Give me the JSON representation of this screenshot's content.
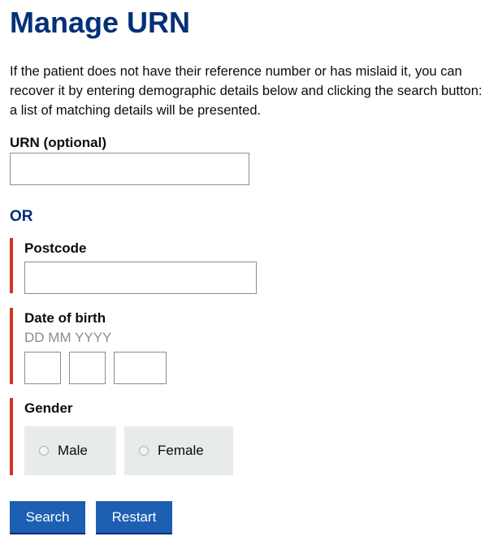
{
  "page": {
    "title": "Manage URN",
    "intro": "If the patient does not have their reference number or has mislaid it, you can recover it by entering demographic details below and clicking the search button: a list of matching details will be presented."
  },
  "urn": {
    "label": "URN (optional)",
    "value": ""
  },
  "separator": "OR",
  "postcode": {
    "label": "Postcode",
    "value": ""
  },
  "dob": {
    "label": "Date of birth",
    "hint": "DD MM YYYY",
    "day": "",
    "month": "",
    "year": ""
  },
  "gender": {
    "label": "Gender",
    "options": [
      "Male",
      "Female"
    ]
  },
  "buttons": {
    "search": "Search",
    "restart": "Restart"
  },
  "colors": {
    "heading": "#003078",
    "error_border": "#d4351c",
    "button": "#1d5fb3"
  }
}
